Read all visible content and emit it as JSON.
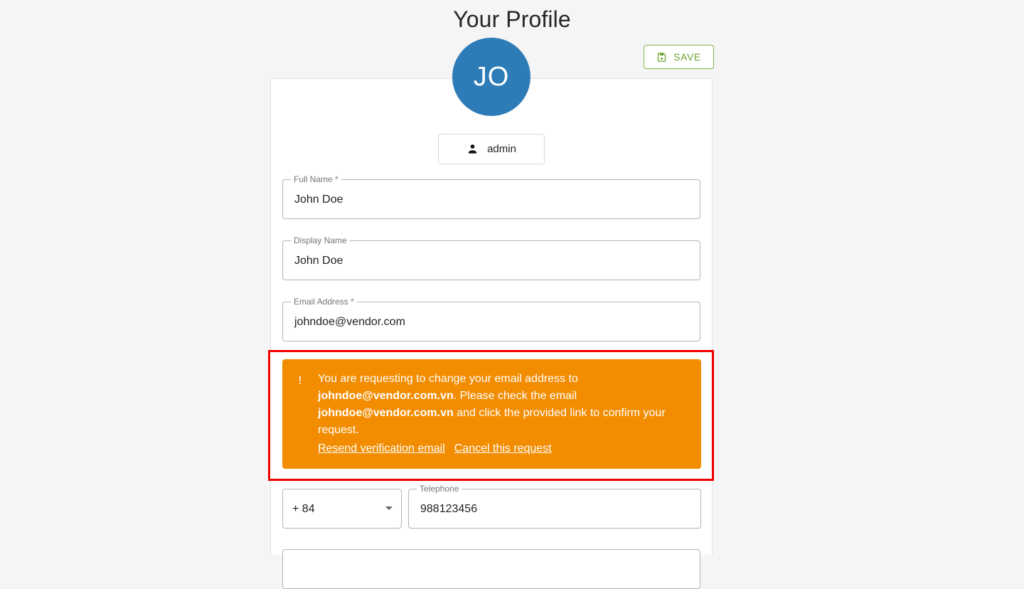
{
  "header": {
    "title": "Your Profile"
  },
  "toolbar": {
    "save_label": "SAVE",
    "save_icon": "save-floppy-icon",
    "save_border_color": "#7cb342",
    "save_text_color": "#6aa332"
  },
  "avatar": {
    "initials": "JO",
    "background_color": "#2d7cb8",
    "text_color": "#ffffff"
  },
  "role_chip": {
    "label": "admin",
    "icon": "person-icon"
  },
  "form": {
    "full_name": {
      "label": "Full Name *",
      "value": "John Doe"
    },
    "display_name": {
      "label": "Display Name",
      "value": "John Doe"
    },
    "email_address": {
      "label": "Email Address *",
      "value": "johndoe@vendor.com"
    },
    "country_code": {
      "value": "+ 84",
      "icon": "chevron-down-icon"
    },
    "telephone": {
      "label": "Telephone",
      "value": "988123456"
    }
  },
  "email_alert": {
    "icon": "exclamation-icon",
    "background_color": "#f28c00",
    "text_color": "#ffffff",
    "text_part1": "You are requesting to change your email address to ",
    "pending_email": "johndoe@vendor.com.vn",
    "text_part2": ". Please check the email ",
    "pending_email_2": "johndoe@vendor.com.vn",
    "text_part3": " and click the provided link to confirm your request.",
    "resend_link": "Resend verification email",
    "cancel_link": "Cancel this request"
  },
  "annotation": {
    "border_color": "#ef0000"
  }
}
